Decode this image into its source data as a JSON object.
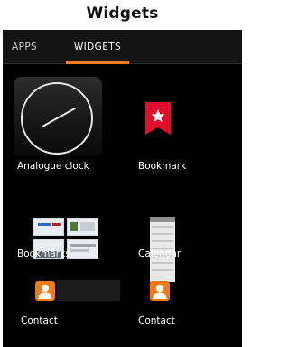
{
  "page": {
    "title": "Widgets"
  },
  "tabs": [
    {
      "label": "APPS",
      "selected": false
    },
    {
      "label": "WIDGETS",
      "selected": true
    }
  ],
  "accent_color": "#f07d1e",
  "widgets": [
    {
      "label": "Analogue clock",
      "icon": "analogue-clock-icon"
    },
    {
      "label": "Bookmark",
      "icon": "bookmark-icon"
    },
    {
      "label": "Bookmarks",
      "icon": "bookmarks-thumbnails-icon"
    },
    {
      "label": "Calendar",
      "icon": "calendar-icon"
    },
    {
      "label": "Contact",
      "icon": "contact-icon"
    },
    {
      "label": "Contact",
      "icon": "contact-icon"
    }
  ]
}
